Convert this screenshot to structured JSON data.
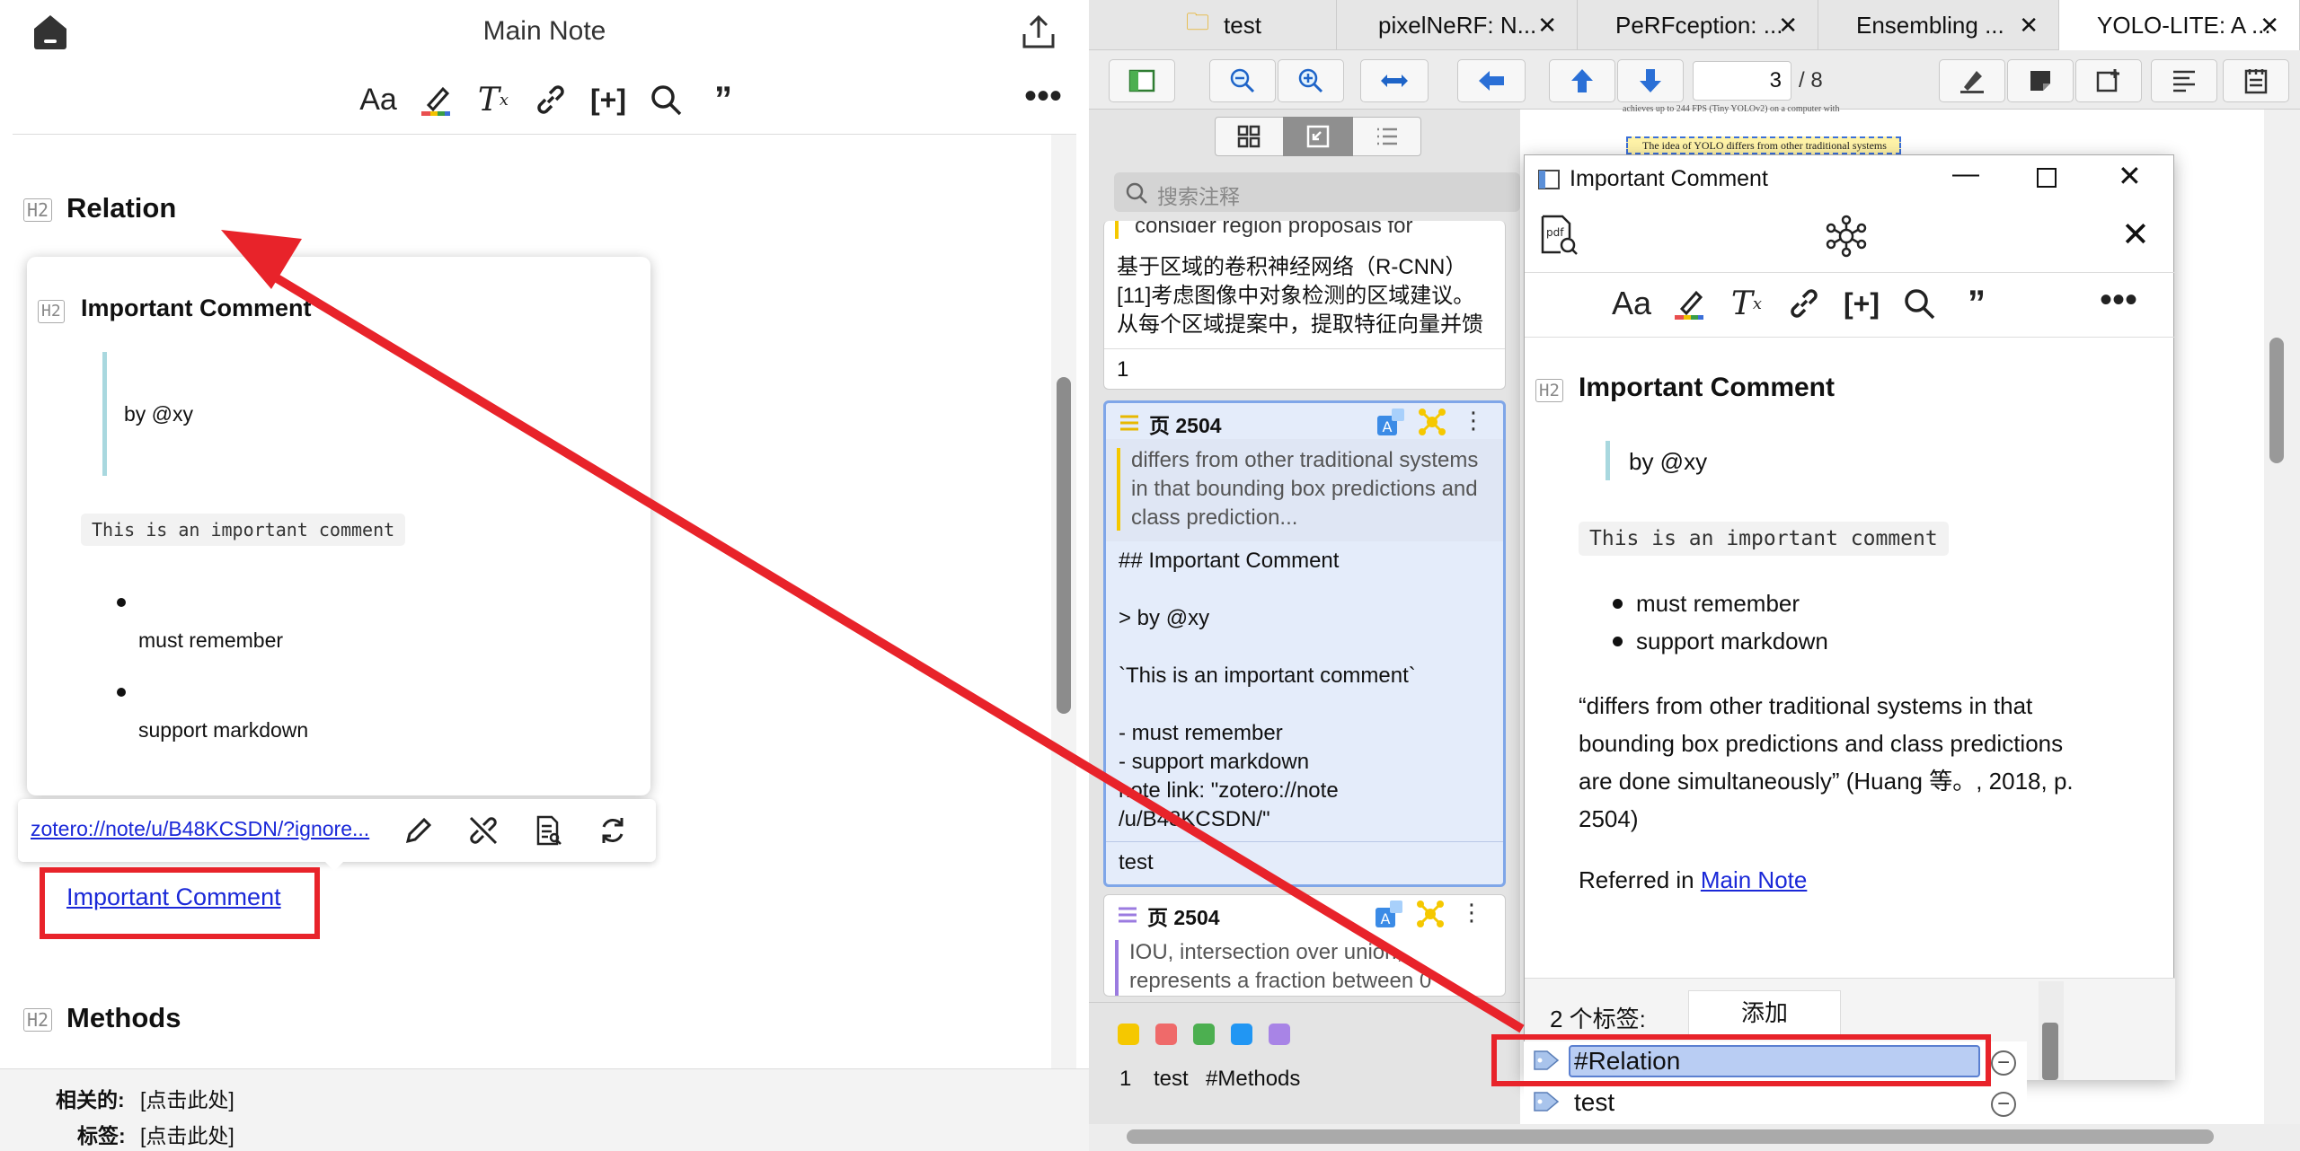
{
  "left_note": {
    "title": "Main Note",
    "sections": {
      "relation": {
        "tag": "H2",
        "title": "Relation"
      },
      "methods": {
        "tag": "H2",
        "title": "Methods"
      }
    },
    "popup": {
      "tag": "H2",
      "title": "Important Comment",
      "quote": "by @xy",
      "code": "This is an important comment",
      "bullets": [
        "must remember",
        "support markdown"
      ]
    },
    "link_toolbar": {
      "url": "zotero://note/u/B48KCSDN/?ignore..."
    },
    "link_text": "Important Comment",
    "footer": {
      "related_label": "相关的:",
      "related_value": "[点击此处]",
      "tags_label": "标签:",
      "tags_value": "[点击此处]"
    }
  },
  "reader": {
    "tabs": [
      "test",
      "pixelNeRF: N...",
      "PeRFception: ...",
      "Ensembling ...",
      "YOLO-LITE: A ..."
    ],
    "page_current": "3",
    "page_total": "/ 8",
    "search_placeholder": "搜索注释",
    "pdf_snippets": [
      "achieves up to 244 FPS (Tiny YOLOv2) on a computer with",
      "The idea of YOLO differs from other traditional systems"
    ],
    "cards": [
      {
        "excerpt": "consider region proposals for",
        "comment": "基于区域的卷积神经网络（R-CNN）[11]考虑图像中对象检测的区域建议。从每个区域提案中，提取特征向量并馈",
        "footer": "1"
      },
      {
        "page": "页 2504",
        "excerpt": "differs from other traditional systems in that bounding box predictions and class prediction...",
        "comment_lines": [
          "## Important Comment",
          "",
          "> by @xy",
          "",
          "`This is an important comment`",
          "",
          "- must remember",
          "- support markdown",
          "note link: \"zotero://note",
          "/u/B48KCSDN/\""
        ],
        "footer": "test"
      },
      {
        "page": "页 2504",
        "excerpt": "IOU, intersection over union, represents a fraction between 0"
      }
    ],
    "swatch_colors": [
      "#f5c800",
      "#ef6a6a",
      "#4caf50",
      "#2196f3",
      "#a884e6"
    ],
    "tag_filters": [
      "1",
      "test",
      "#Methods"
    ]
  },
  "comment_window": {
    "title": "Important Comment",
    "heading_tag": "H2",
    "heading": "Important Comment",
    "quote": "by @xy",
    "code": "This is an important comment",
    "bullets": [
      "must remember",
      "support markdown"
    ],
    "citation_lines": [
      "“differs from other traditional systems in that",
      "bounding box predictions and class predictions",
      "are done simultaneously” (Huang 等。, 2018, p.",
      "2504)"
    ],
    "referred_prefix": "Referred in ",
    "referred_link": "Main Note",
    "tags_count": "2 个标签:",
    "add_button": "添加",
    "tags": [
      "#Relation",
      "test"
    ]
  },
  "annotation_color": "#e8232a"
}
